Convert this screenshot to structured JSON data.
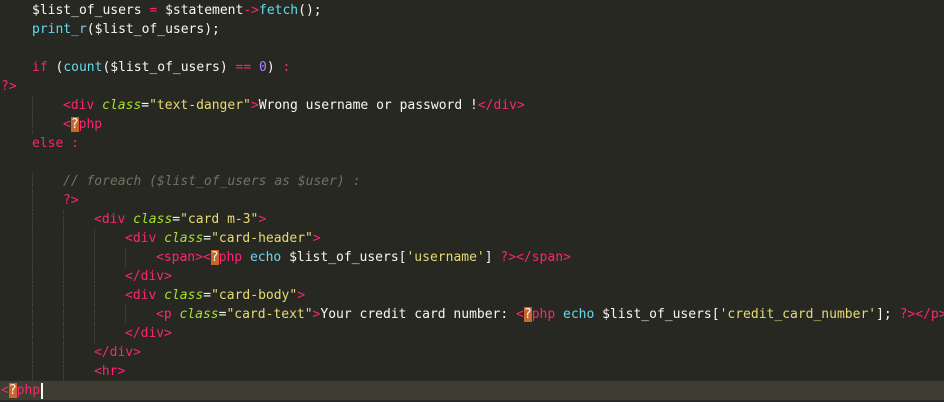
{
  "editor": {
    "lines": [
      {
        "indent": 1,
        "tokens": [
          {
            "c": "t-var",
            "t": "$list_of_users"
          },
          {
            "c": "t-punc",
            "t": " "
          },
          {
            "c": "t-op",
            "t": "="
          },
          {
            "c": "t-punc",
            "t": " "
          },
          {
            "c": "t-var",
            "t": "$statement"
          },
          {
            "c": "t-op",
            "t": "->"
          },
          {
            "c": "t-func",
            "t": "fetch"
          },
          {
            "c": "t-punc",
            "t": "();"
          }
        ]
      },
      {
        "indent": 1,
        "tokens": [
          {
            "c": "t-func",
            "t": "print_r"
          },
          {
            "c": "t-punc",
            "t": "("
          },
          {
            "c": "t-var",
            "t": "$list_of_users"
          },
          {
            "c": "t-punc",
            "t": ");"
          }
        ]
      },
      {
        "indent": 0,
        "tokens": []
      },
      {
        "indent": 1,
        "tokens": [
          {
            "c": "t-kw",
            "t": "if"
          },
          {
            "c": "t-punc",
            "t": " ("
          },
          {
            "c": "t-func",
            "t": "count"
          },
          {
            "c": "t-punc",
            "t": "("
          },
          {
            "c": "t-var",
            "t": "$list_of_users"
          },
          {
            "c": "t-punc",
            "t": ") "
          },
          {
            "c": "t-op",
            "t": "=="
          },
          {
            "c": "t-punc",
            "t": " "
          },
          {
            "c": "t-num",
            "t": "0"
          },
          {
            "c": "t-punc",
            "t": ") "
          },
          {
            "c": "t-op",
            "t": ":"
          }
        ]
      },
      {
        "indent": 0,
        "tokens": [
          {
            "c": "t-php",
            "t": "?>"
          }
        ]
      },
      {
        "indent": 2,
        "tokens": [
          {
            "c": "t-tag",
            "t": "<div"
          },
          {
            "c": "t-punc",
            "t": " "
          },
          {
            "c": "t-attr",
            "t": "class"
          },
          {
            "c": "t-punc",
            "t": "="
          },
          {
            "c": "t-str",
            "t": "\"text-danger\""
          },
          {
            "c": "t-tag",
            "t": ">"
          },
          {
            "c": "t-text",
            "t": "Wrong username or password !"
          },
          {
            "c": "t-tag",
            "t": "</div>"
          }
        ]
      },
      {
        "indent": 2,
        "tokens": [
          {
            "c": "t-php",
            "t": "<"
          },
          {
            "c": "t-php-q",
            "t": "?"
          },
          {
            "c": "t-php",
            "t": "php"
          }
        ]
      },
      {
        "indent": 1,
        "tokens": [
          {
            "c": "t-kw",
            "t": "else"
          },
          {
            "c": "t-punc",
            "t": " "
          },
          {
            "c": "t-op",
            "t": ":"
          }
        ]
      },
      {
        "indent": 0,
        "tokens": []
      },
      {
        "indent": 2,
        "tokens": [
          {
            "c": "t-comment",
            "t": "// foreach ($list_of_users as $user) :"
          }
        ]
      },
      {
        "indent": 2,
        "tokens": [
          {
            "c": "t-php",
            "t": "?>"
          }
        ]
      },
      {
        "indent": 3,
        "tokens": [
          {
            "c": "t-tag",
            "t": "<div"
          },
          {
            "c": "t-punc",
            "t": " "
          },
          {
            "c": "t-attr",
            "t": "class"
          },
          {
            "c": "t-punc",
            "t": "="
          },
          {
            "c": "t-str",
            "t": "\"card m-3\""
          },
          {
            "c": "t-tag",
            "t": ">"
          }
        ]
      },
      {
        "indent": 4,
        "tokens": [
          {
            "c": "t-tag",
            "t": "<div"
          },
          {
            "c": "t-punc",
            "t": " "
          },
          {
            "c": "t-attr",
            "t": "class"
          },
          {
            "c": "t-punc",
            "t": "="
          },
          {
            "c": "t-str",
            "t": "\"card-header\""
          },
          {
            "c": "t-tag",
            "t": ">"
          }
        ]
      },
      {
        "indent": 5,
        "tokens": [
          {
            "c": "t-tag",
            "t": "<span>"
          },
          {
            "c": "t-php",
            "t": "<"
          },
          {
            "c": "t-php-q",
            "t": "?"
          },
          {
            "c": "t-php",
            "t": "php"
          },
          {
            "c": "t-punc",
            "t": " "
          },
          {
            "c": "t-func",
            "t": "echo"
          },
          {
            "c": "t-punc",
            "t": " "
          },
          {
            "c": "t-var",
            "t": "$list_of_users"
          },
          {
            "c": "t-punc",
            "t": "["
          },
          {
            "c": "t-str",
            "t": "'username'"
          },
          {
            "c": "t-punc",
            "t": "] "
          },
          {
            "c": "t-php",
            "t": "?>"
          },
          {
            "c": "t-tag",
            "t": "</span>"
          }
        ]
      },
      {
        "indent": 4,
        "tokens": [
          {
            "c": "t-tag",
            "t": "</div>"
          }
        ]
      },
      {
        "indent": 4,
        "tokens": [
          {
            "c": "t-tag",
            "t": "<div"
          },
          {
            "c": "t-punc",
            "t": " "
          },
          {
            "c": "t-attr",
            "t": "class"
          },
          {
            "c": "t-punc",
            "t": "="
          },
          {
            "c": "t-str",
            "t": "\"card-body\""
          },
          {
            "c": "t-tag",
            "t": ">"
          }
        ]
      },
      {
        "indent": 5,
        "tokens": [
          {
            "c": "t-tag",
            "t": "<p"
          },
          {
            "c": "t-punc",
            "t": " "
          },
          {
            "c": "t-attr",
            "t": "class"
          },
          {
            "c": "t-punc",
            "t": "="
          },
          {
            "c": "t-str",
            "t": "\"card-text\""
          },
          {
            "c": "t-tag",
            "t": ">"
          },
          {
            "c": "t-text",
            "t": "Your credit card number: "
          },
          {
            "c": "t-php",
            "t": "<"
          },
          {
            "c": "t-php-q",
            "t": "?"
          },
          {
            "c": "t-php",
            "t": "php"
          },
          {
            "c": "t-punc",
            "t": " "
          },
          {
            "c": "t-func",
            "t": "echo"
          },
          {
            "c": "t-punc",
            "t": " "
          },
          {
            "c": "t-var",
            "t": "$list_of_users"
          },
          {
            "c": "t-punc",
            "t": "["
          },
          {
            "c": "t-str",
            "t": "'credit_card_number'"
          },
          {
            "c": "t-punc",
            "t": "]; "
          },
          {
            "c": "t-php",
            "t": "?>"
          },
          {
            "c": "t-tag",
            "t": "</p>"
          }
        ]
      },
      {
        "indent": 4,
        "tokens": [
          {
            "c": "t-tag",
            "t": "</div>"
          }
        ]
      },
      {
        "indent": 3,
        "tokens": [
          {
            "c": "t-tag",
            "t": "</div>"
          }
        ]
      },
      {
        "indent": 3,
        "tokens": [
          {
            "c": "t-tag",
            "t": "<hr>"
          }
        ]
      },
      {
        "indent": 0,
        "active": true,
        "cursor": true,
        "tokens": [
          {
            "c": "t-php",
            "t": "<"
          },
          {
            "c": "t-php-q",
            "t": "?"
          },
          {
            "c": "t-php",
            "t": "php"
          }
        ]
      }
    ]
  }
}
